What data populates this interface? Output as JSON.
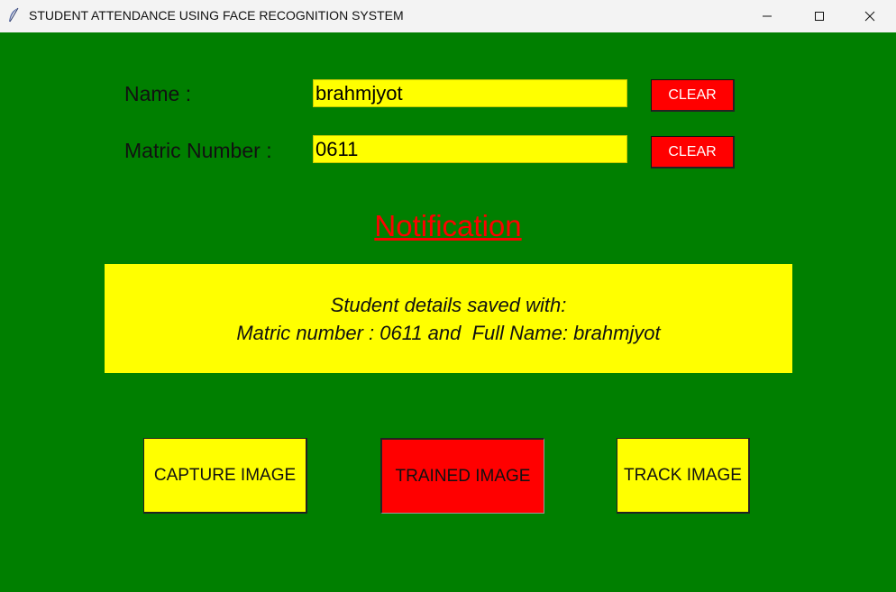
{
  "window": {
    "title": "STUDENT ATTENDANCE USING FACE RECOGNITION SYSTEM",
    "icon": "feather-icon",
    "controls": [
      "minimize-icon",
      "maximize-icon",
      "close-icon"
    ]
  },
  "form": {
    "name_label": "Name :",
    "name_value": "brahmjyot",
    "matric_label": "Matric Number :",
    "matric_value": "0611",
    "clear_label_1": "CLEAR",
    "clear_label_2": "CLEAR"
  },
  "notification": {
    "title": "Notification",
    "line1": "Student details saved with:",
    "line2": "Matric number : 0611 and  Full Name: brahmjyot"
  },
  "actions": {
    "capture_label": "CAPTURE IMAGE",
    "trained_label": "TRAINED IMAGE",
    "track_label": "TRACK IMAGE"
  },
  "colors": {
    "background": "#007f00",
    "field": "#ffff00",
    "clear_button": "#ff0000",
    "notification_title": "#ff0000",
    "capture_button": "#ffff00",
    "trained_button": "#ff0000",
    "track_button": "#ffff00"
  }
}
